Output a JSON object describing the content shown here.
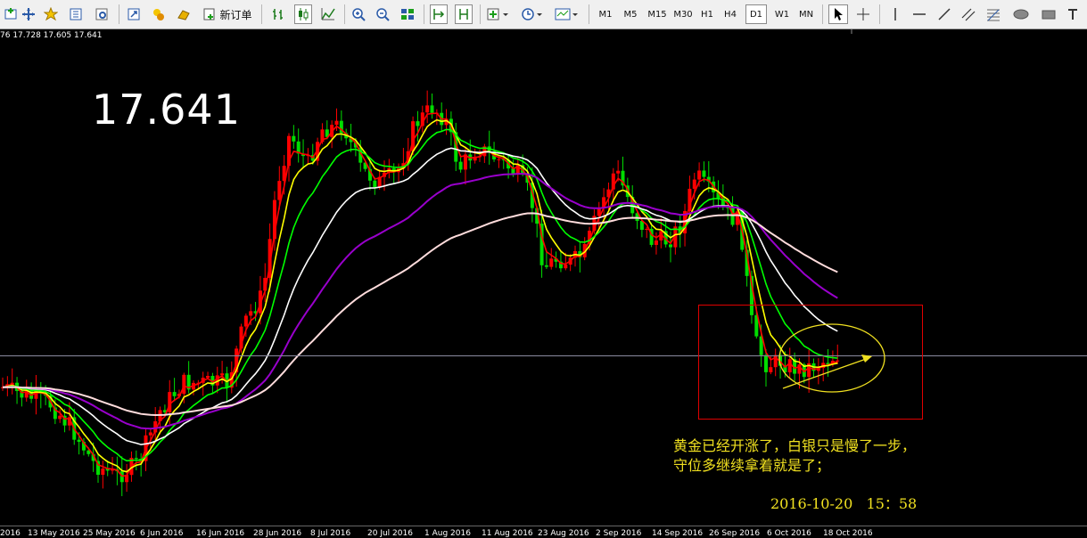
{
  "toolbar": {
    "new_order_label": "新订单",
    "timeframes": [
      "M1",
      "M5",
      "M15",
      "M30",
      "H1",
      "H4",
      "D1",
      "W1",
      "MN"
    ],
    "active_timeframe": "D1",
    "icons": [
      "new-chart-icon",
      "crosshair-icon",
      "favorites-icon",
      "navigator-icon",
      "data-window-icon",
      "fullscreen-icon",
      "market-watch-icon",
      "gold-icon",
      "new-order-icon",
      "bar-chart-icon",
      "candlestick-icon",
      "line-chart-icon",
      "zoom-in-icon",
      "zoom-out-icon",
      "tile-windows-icon",
      "scroll-end-icon",
      "autoscroll-icon",
      "indicators-icon",
      "periods-icon",
      "templates-icon",
      "cursor-icon",
      "crosshair-tool-icon",
      "vertical-line-icon",
      "horizontal-line-icon",
      "trendline-icon",
      "channel-icon",
      "fibonacci-icon",
      "text-icon",
      "ellipse-icon",
      "rectangle-icon"
    ]
  },
  "ohlc_text": "76 17.728 17.605 17.641",
  "current_price": "17.641",
  "annotation": {
    "line1": "黄金已经开涨了，白银只是慢了一步，",
    "line2": "守位多继续拿着就是了；",
    "timestamp": "2016-10-20   15：58"
  },
  "date_labels": [
    "2016",
    "13 May 2016",
    "25 May 2016",
    "6 Jun 2016",
    "16 Jun 2016",
    "28 Jun 2016",
    "8 Jul 2016",
    "20 Jul 2016",
    "1 Aug 2016",
    "11 Aug 2016",
    "23 Aug 2016",
    "2 Sep 2016",
    "14 Sep 2016",
    "26 Sep 2016",
    "6 Oct 2016",
    "18 Oct 2016"
  ],
  "colors": {
    "background": "#000000",
    "bull_candle": "#ff0000",
    "bear_candle": "#00dd00",
    "ma_red": "#ff0000",
    "ma_yellow": "#ffff00",
    "ma_green": "#00ff00",
    "ma_white": "#ffffff",
    "ma_purple": "#9900cc",
    "ma_pink": "#ffdcdc",
    "annotation": "#f0e020",
    "box": "#ff0000"
  }
}
